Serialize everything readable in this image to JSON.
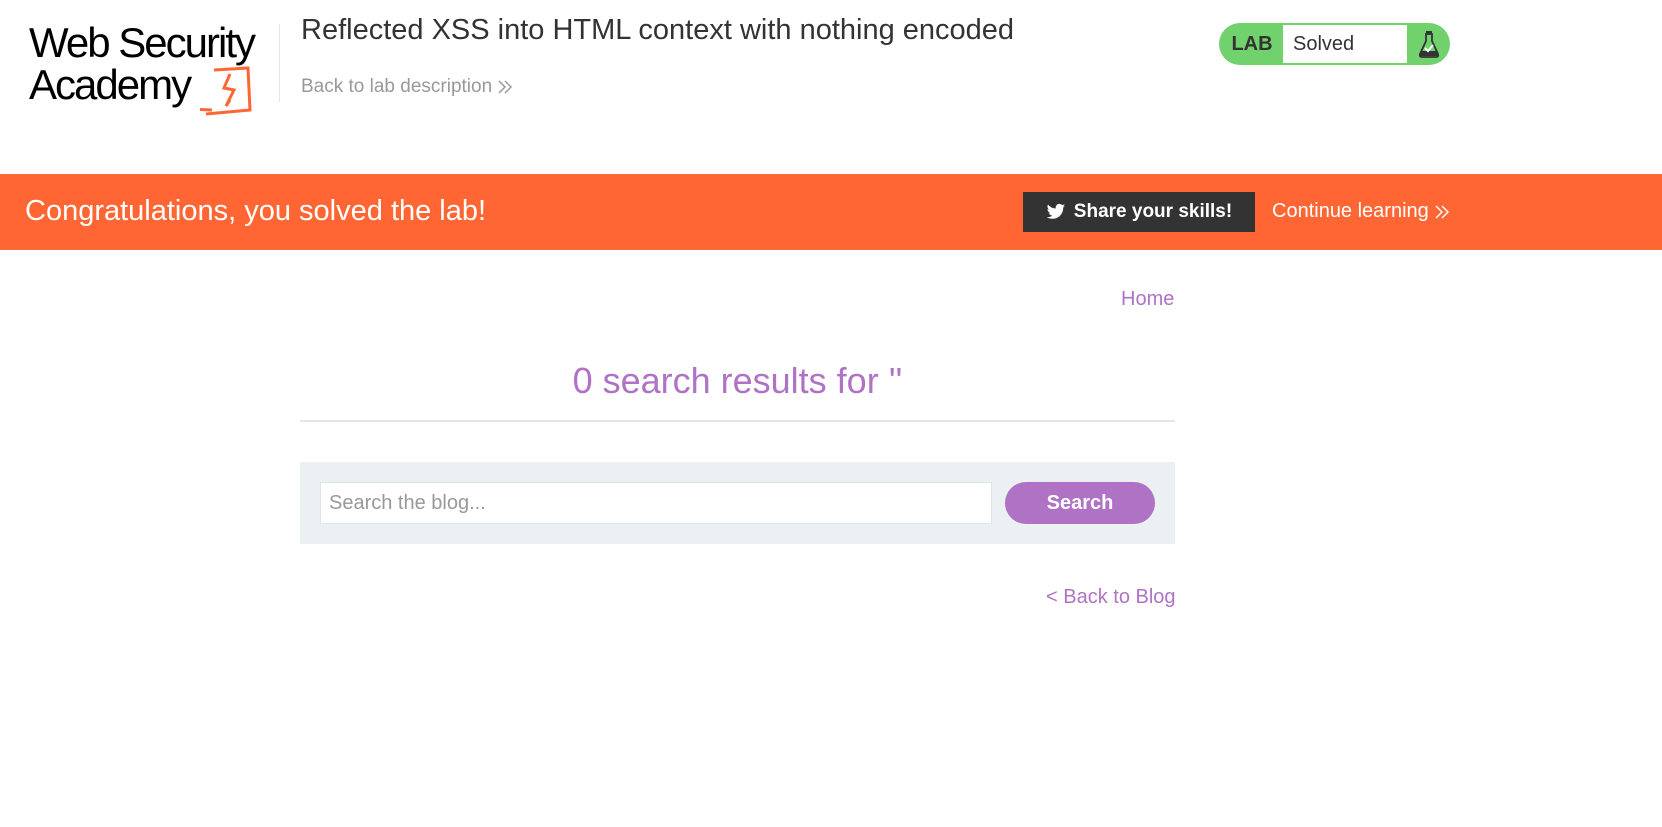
{
  "header": {
    "logo": {
      "line1": "Web Security",
      "line2": "Academy"
    },
    "lab_title": "Reflected XSS into HTML context with nothing encoded",
    "back_to_description": "Back to lab description"
  },
  "lab_status": {
    "tag": "LAB",
    "state": "Solved",
    "icon": "flask-icon",
    "color": "#70d16d"
  },
  "banner": {
    "message": "Congratulations, you solved the lab!",
    "share_label": "Share your skills!",
    "share_icon": "twitter-icon",
    "continue_label": "Continue learning",
    "color": "#ff6633"
  },
  "nav": {
    "home": "Home"
  },
  "main": {
    "results_heading": "0 search results for ''",
    "search": {
      "placeholder": "Search the blog...",
      "value": "",
      "button_label": "Search"
    },
    "back_to_blog": "< Back to Blog",
    "accent_color": "#b072c5"
  }
}
